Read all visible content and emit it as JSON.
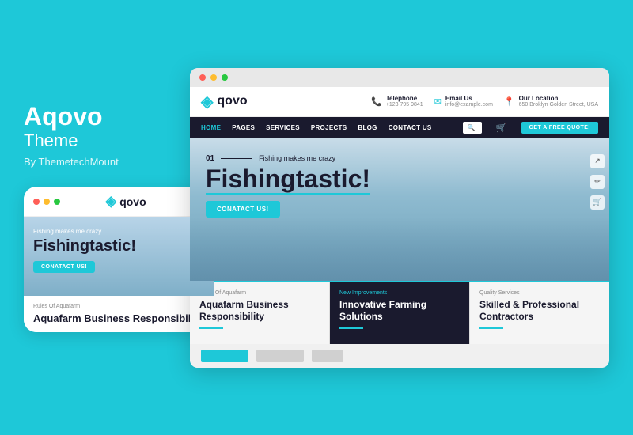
{
  "brand": {
    "name": "Aqovo",
    "theme_label": "Theme",
    "by_label": "By ThemetechMount"
  },
  "mobile": {
    "logo_text": "qovo",
    "hero_subtitle": "Fishing makes me crazy",
    "hero_title": "Fishingtastic!",
    "cta_label": "CONATACT US!",
    "card_label": "Rules Of Aquafarm",
    "card_title": "Aquafarm Business Responsibility"
  },
  "desktop": {
    "logo_text": "qovo",
    "contact": {
      "phone_label": "Telephone",
      "phone_value": "+123 795 9841",
      "email_label": "Email Us",
      "email_value": "info@example.com",
      "location_label": "Our Location",
      "location_value": "650 Broklyn Golden Street, USA"
    },
    "nav": {
      "items": [
        "HOME",
        "PAGES",
        "SERVICES",
        "PROJECTS",
        "BLOG",
        "CONTACT US"
      ],
      "cta": "GET A FREE QUOTE!"
    },
    "hero": {
      "number": "01",
      "subtitle": "Fishing makes me crazy",
      "title": "Fishingtastic!",
      "cta": "CONATACT US!"
    },
    "cards": [
      {
        "category": "Rules Of Aquafarm",
        "title": "Aquafarm Business Responsibility",
        "highlight": false
      },
      {
        "category": "New Improvements",
        "title": "Innovative Farming Solutions",
        "highlight": true
      },
      {
        "category": "Quality Services",
        "title": "Skilled & Professional Contractors",
        "highlight": false
      }
    ]
  },
  "colors": {
    "accent": "#1ec8d8",
    "dark": "#1a1a2e",
    "bg": "#1ec8d8"
  }
}
